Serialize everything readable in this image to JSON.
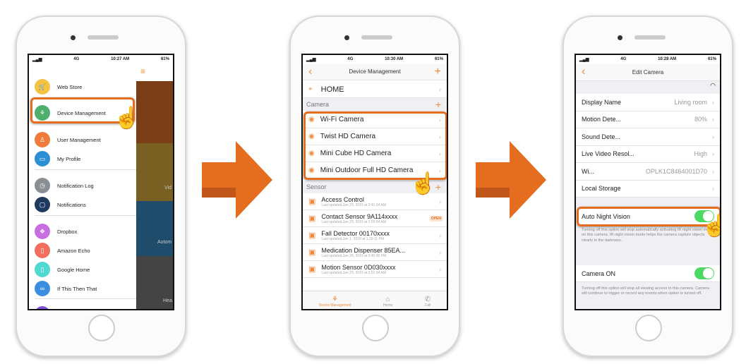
{
  "accent": "#e56d1f",
  "phone1": {
    "status": {
      "carrier": "4G",
      "time": "10:27 AM",
      "battery": "61%"
    },
    "menu": [
      {
        "label": "Web Store",
        "icon": "cart-icon",
        "color": "#f5c242"
      },
      {
        "label": "Device Management",
        "icon": "device-tree-icon",
        "color": "#4caf6a",
        "highlighted": true
      },
      {
        "label": "User Management",
        "icon": "users-icon",
        "color": "#f07a3a"
      },
      {
        "label": "My Profile",
        "icon": "id-card-icon",
        "color": "#2b8fd6"
      },
      {
        "label": "Notification Log",
        "icon": "history-icon",
        "color": "#8a8f93"
      },
      {
        "label": "Notifications",
        "icon": "notification-icon",
        "color": "#1f3a5f"
      },
      {
        "label": "Dropbox",
        "icon": "dropbox-icon",
        "color": "#c86fe0"
      },
      {
        "label": "Amazon Echo",
        "icon": "echo-icon",
        "color": "#f26f5e"
      },
      {
        "label": "Google Home",
        "icon": "google-home-icon",
        "color": "#4fd9d0"
      },
      {
        "label": "If This Then That",
        "icon": "ifttt-icon",
        "color": "#3b8de0"
      }
    ],
    "tiles": [
      "Vid",
      "Autom",
      "Hea"
    ]
  },
  "phone2": {
    "status": {
      "carrier": "4G",
      "time": "10:30 AM",
      "battery": "61%"
    },
    "title": "Device Management",
    "home": "HOME",
    "camera_section": "Camera",
    "cameras": [
      "Wi-Fi Camera",
      "Twist HD Camera",
      "Mini Cube HD Camera",
      "Mini Outdoor Full HD Camera"
    ],
    "sensor_section": "Sensor",
    "sensors": [
      {
        "name": "Access Control",
        "updated": "Last updated:Jan 29, 2019 at 2:41:24 AM"
      },
      {
        "name": "Contact Sensor 9A114xxxx",
        "updated": "Last updated:Jan 29, 2019 at 1:03:04 AM",
        "badge": "OPEN"
      },
      {
        "name": "Fall Detector 00170xxxx",
        "updated": "Last updated:Jan 1, 2019 at 1:29:11 PM"
      },
      {
        "name": "Medication Dispenser 85EA...",
        "updated": "Last updated:Jan 28, 2019 at 3:45:00 PM"
      },
      {
        "name": "Motion Sensor 0D030xxxx",
        "updated": "Last updated:Jan 29, 2019 at 5:51:34 AM"
      }
    ],
    "tabs": [
      {
        "label": "Device Management",
        "active": true
      },
      {
        "label": "Home"
      },
      {
        "label": "Call"
      }
    ]
  },
  "phone3": {
    "status": {
      "carrier": "4G",
      "time": "10:28 AM",
      "battery": "61%"
    },
    "title": "Edit Camera",
    "rows": [
      {
        "label": "Display Name",
        "value": "Living room"
      },
      {
        "label": "Motion Dete...",
        "value": "80%"
      },
      {
        "label": "Sound Dete...",
        "value": ""
      },
      {
        "label": "Live Video Resol...",
        "value": "High"
      },
      {
        "label": "Wi...",
        "value": "OPLK1C8464001D70"
      },
      {
        "label": "Local Storage",
        "value": ""
      }
    ],
    "night_vision": {
      "label": "Auto Night Vision",
      "on": true,
      "desc": "Turning off this option will stop automatically activating IR night vision mode on this camera. IR night vision mode helps the camera capture objects clearly in the darkness."
    },
    "camera_on": {
      "label": "Camera ON",
      "on": true,
      "desc": "Turning off this option will stop all viewing access to this camera. Camera will continue to trigger or record any events when option is turned off."
    }
  }
}
